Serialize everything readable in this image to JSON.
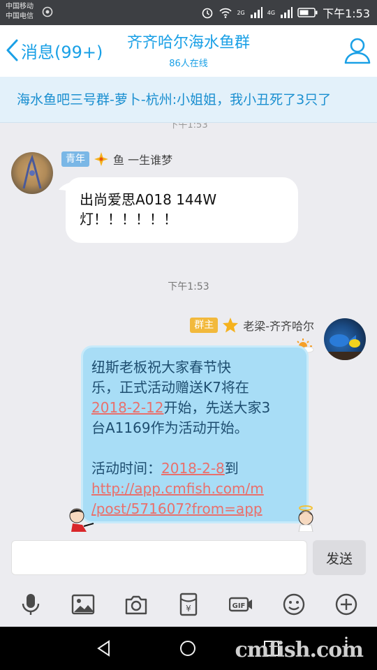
{
  "status_bar": {
    "carrier_1": "中国移动",
    "carrier_2": "中国电信",
    "net_1": "2G",
    "net_2": "4G",
    "time": "下午1:53"
  },
  "header": {
    "back_label": "消息(99+)",
    "title": "齐齐哈尔海水鱼群",
    "subtitle": "86人在线"
  },
  "notice": {
    "text": "海水鱼吧三号群-萝卜-杭州:小姐姐，我小丑死了3只了"
  },
  "messages": [
    {
      "badge": "青年",
      "sender": "鱼 一生谁梦",
      "text_line1": "出尚爱思A018 144W",
      "text_line2": "灯！！！！！！"
    },
    {
      "timestamp": "下午1:53"
    },
    {
      "badge": "群主",
      "sender": "老梁-齐齐哈尔",
      "line1": "纽斯老板祝大家春节快",
      "line2_pre": "乐，正式活动赠送K7将在",
      "line3_link": "2018-2-12",
      "line3_post": "开始，先送大家3",
      "line4": "台A1169作为活动开始。",
      "line5_pre": "活动时间：",
      "line5_link": "2018-2-8",
      "line5_post": "到",
      "line6_link": "http://app.cmfish.com/m",
      "line7_link": "/post/571607?from=app"
    }
  ],
  "input": {
    "send_label": "发送"
  },
  "toolbar": {
    "icons": [
      "microphone-icon",
      "image-icon",
      "camera-icon",
      "red-packet-icon",
      "gif-icon",
      "emoji-icon",
      "plus-icon"
    ]
  },
  "watermark": "cmfish.com",
  "colors": {
    "accent": "#1aa0e6",
    "bubble_blue": "#a8ddf6",
    "link": "#e9706c"
  }
}
